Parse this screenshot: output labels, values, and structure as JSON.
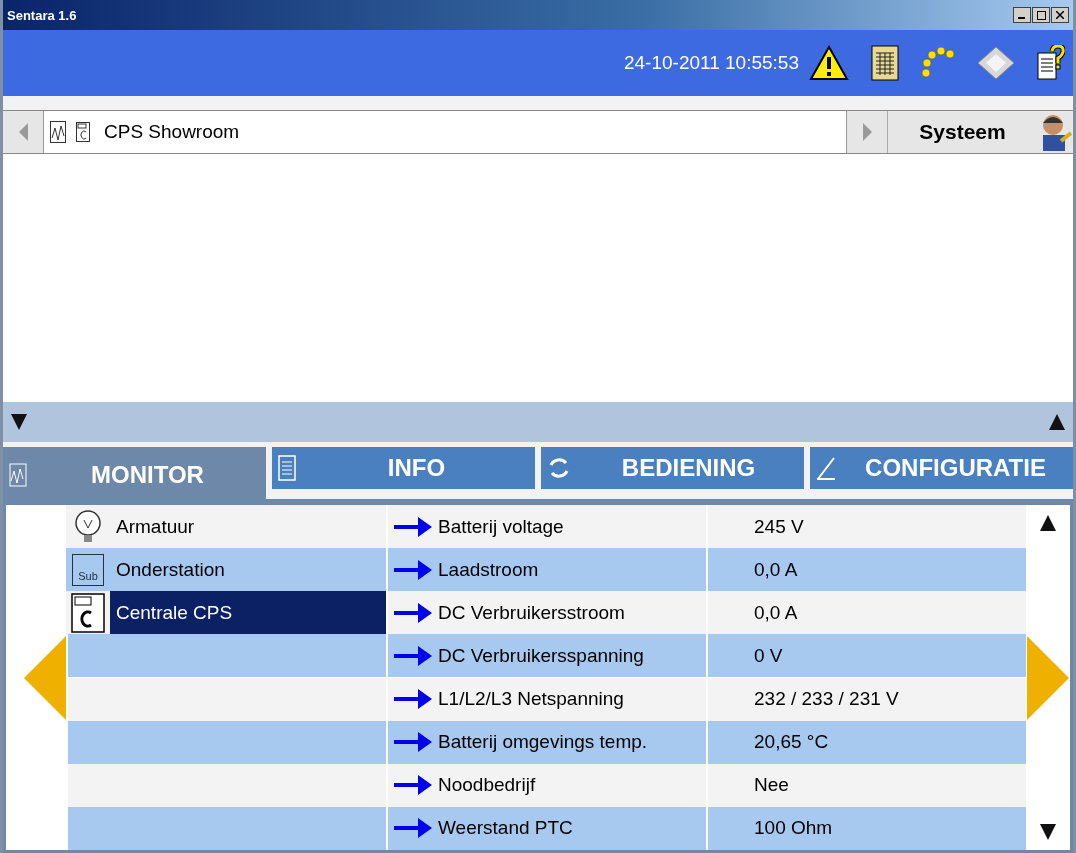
{
  "window": {
    "title": "Sentara 1.6"
  },
  "header": {
    "datetime": "24-10-2011 10:55:53"
  },
  "breadcrumb": {
    "path": "CPS Showroom",
    "menu": "Systeem"
  },
  "tabs": [
    {
      "label": "MONITOR",
      "selected": true,
      "kind": "chart"
    },
    {
      "label": "INFO",
      "selected": false,
      "kind": "document"
    },
    {
      "label": "BEDIENING",
      "selected": false,
      "kind": "refresh"
    },
    {
      "label": "CONFIGURATIE",
      "selected": false,
      "kind": "pencil"
    }
  ],
  "tree": [
    {
      "label": "Armatuur",
      "kind": "lamp",
      "selected": false
    },
    {
      "label": "Onderstation",
      "kind": "substation",
      "icon_text": "Sub",
      "selected": false
    },
    {
      "label": "Centrale CPS",
      "kind": "central",
      "selected": true
    }
  ],
  "readings": [
    {
      "label": "Batterij voltage",
      "value": "245 V"
    },
    {
      "label": "Laadstroom",
      "value": "0,0 A"
    },
    {
      "label": "DC Verbruikersstroom",
      "value": "0,0 A"
    },
    {
      "label": "DC Verbruikersspanning",
      "value": "0 V"
    },
    {
      "label": "L1/L2/L3 Netspanning",
      "value": "232 / 233 / 231 V"
    },
    {
      "label": "Batterij omgevings temp.",
      "value": "20,65 °C"
    },
    {
      "label": "Noodbedrijf",
      "value": "Nee"
    },
    {
      "label": "Weerstand PTC",
      "value": "100 Ohm"
    }
  ]
}
